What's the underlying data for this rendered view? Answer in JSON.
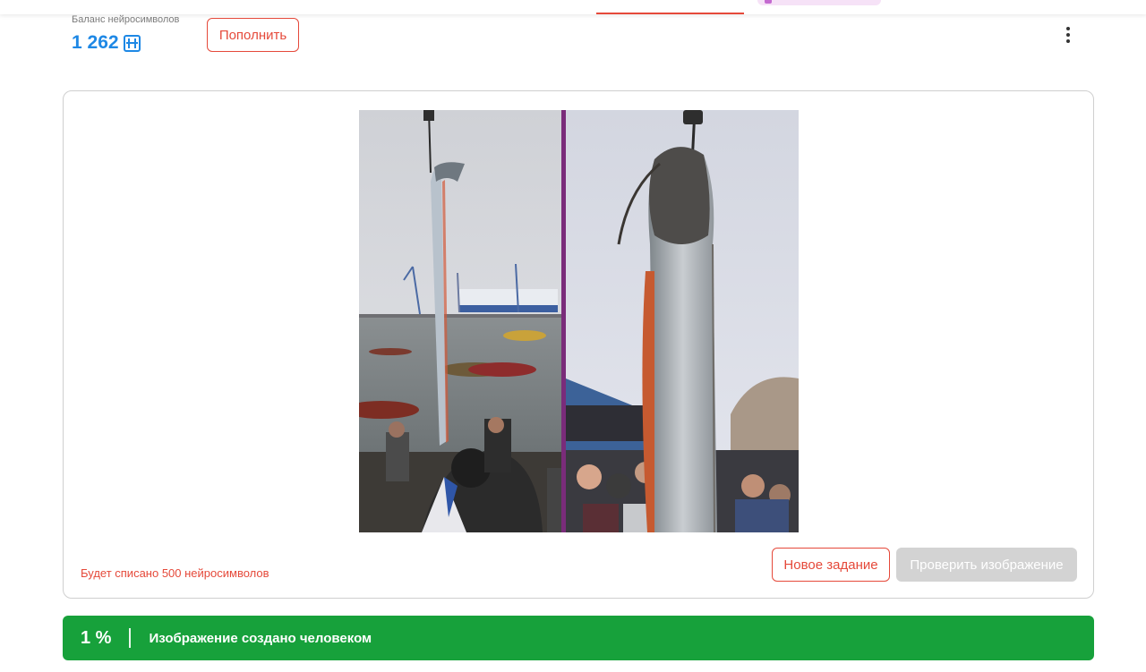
{
  "balance": {
    "label": "Баланс нейросимволов",
    "value": "1 262",
    "currency_icon": "neurosymbol-coin-icon"
  },
  "topup_button": {
    "label": "Пополнить"
  },
  "menu": {
    "icon": "more-vertical-icon"
  },
  "task": {
    "charge_note": "Будет списано 500 нейросимволов",
    "new_task_label": "Новое задание",
    "check_image_label": "Проверить изображение",
    "check_image_enabled": false
  },
  "result": {
    "percent": "1 %",
    "text": "Изображение создано человеком"
  },
  "colors": {
    "accent_red": "#e5493a",
    "balance_blue": "#1e88e5",
    "result_green": "#17a13b",
    "disabled_gray": "#d3d3d3"
  }
}
